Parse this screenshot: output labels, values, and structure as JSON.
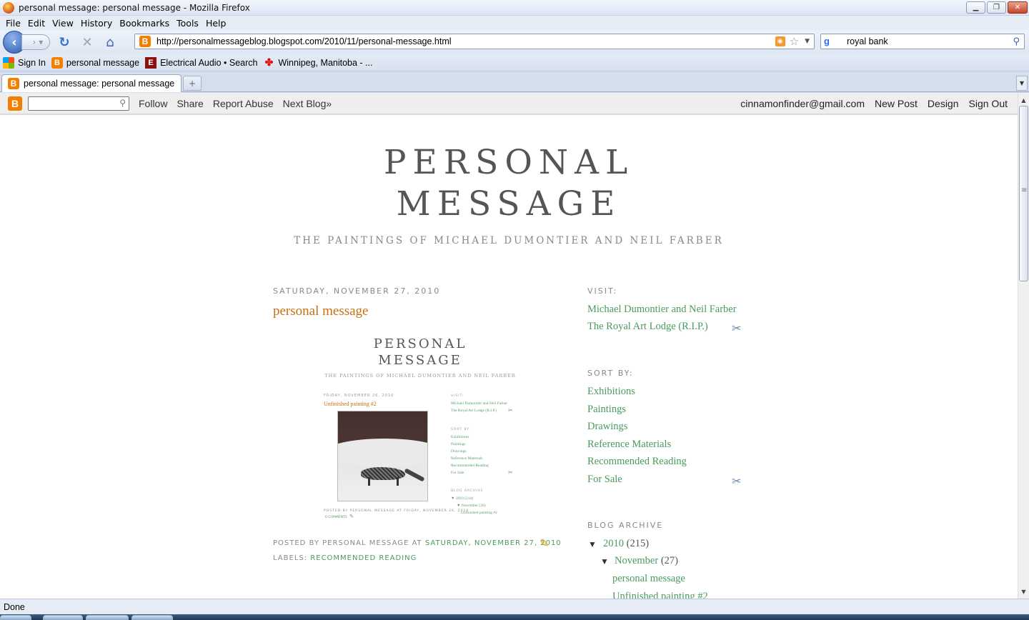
{
  "window": {
    "title": "personal message: personal message - Mozilla Firefox"
  },
  "menu": [
    "File",
    "Edit",
    "View",
    "History",
    "Bookmarks",
    "Tools",
    "Help"
  ],
  "nav": {
    "url": "http://personalmessageblog.blogspot.com/2010/11/personal-message.html",
    "search_value": "royal bank"
  },
  "bookmarks": [
    "Sign In",
    "personal message",
    "Electrical Audio • Search",
    "Winnipeg, Manitoba - ..."
  ],
  "tab": {
    "label": "personal message: personal message"
  },
  "blogger": {
    "links": [
      "Follow",
      "Share",
      "Report Abuse",
      "Next Blog»"
    ],
    "email": "cinnamonfinder@gmail.com",
    "right_links": [
      "New Post",
      "Design",
      "Sign Out"
    ]
  },
  "blog": {
    "title_line1": "PERSONAL",
    "title_line2": "MESSAGE",
    "description": "THE PAINTINGS OF MICHAEL DUMONTIER AND NEIL FARBER"
  },
  "post": {
    "date": "SATURDAY, NOVEMBER 27, 2010",
    "title": "personal message",
    "posted_by_prefix": "POSTED BY PERSONAL MESSAGE AT",
    "posted_time": "SATURDAY, NOVEMBER 27, 2010",
    "labels_prefix": "LABELS:",
    "label": "RECOMMENDED READING"
  },
  "thumbnail": {
    "title_line1": "PERSONAL",
    "title_line2": "MESSAGE",
    "description": "THE PAINTINGS OF MICHAEL DUMONTIER AND NEIL FARBER",
    "date": "FRIDAY, NOVEMBER 26, 2010",
    "post_title": "Unfinished painting #2",
    "visit": "VISIT:",
    "visit_links": [
      "Michael Dumontier and Neil Farber",
      "The Royal Art Lodge (R.I.P.)"
    ],
    "sort_by": "SORT BY:",
    "sort_links": [
      "Exhibitions",
      "Paintings",
      "Drawings",
      "Reference Materials",
      "Recommended Reading",
      "For Sale"
    ],
    "archive": "BLOG ARCHIVE",
    "archive_year": "▼ 2010 (214)",
    "archive_month": "▼ November (26)",
    "archive_post": "Unfinished painting #2",
    "footer": "POSTED BY PERSONAL MESSAGE AT FRIDAY, NOVEMBER 26, 2010",
    "comments": "0 COMMENTS"
  },
  "sidebar": {
    "visit_heading": "VISIT:",
    "visit_links": [
      "Michael Dumontier and Neil Farber",
      "The Royal Art Lodge (R.I.P.)"
    ],
    "sort_heading": "SORT BY:",
    "sort_links": [
      "Exhibitions",
      "Paintings",
      "Drawings",
      "Reference Materials",
      "Recommended Reading",
      "For Sale"
    ],
    "archive_heading": "BLOG ARCHIVE",
    "archive_year": "2010",
    "archive_year_count": "(215)",
    "archive_month": "November",
    "archive_month_count": "(27)",
    "archive_posts": [
      "personal message",
      "Unfinished painting #2"
    ]
  },
  "status": {
    "text": "Done"
  },
  "colors": {
    "post_title": "#c8700e",
    "link": "#4a9a5e",
    "blogger": "#f57d00"
  }
}
